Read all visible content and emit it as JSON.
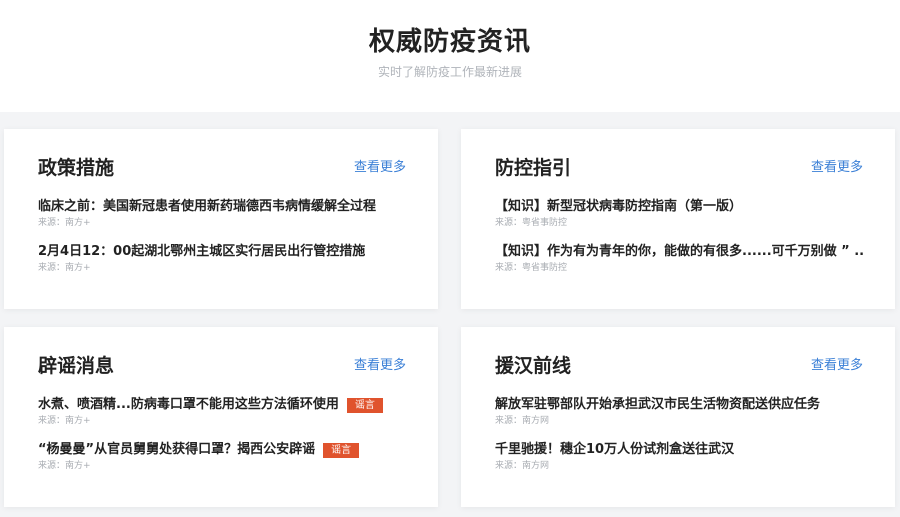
{
  "header": {
    "title": "权威防疫资讯",
    "subtitle": "实时了解防疫工作最新进展"
  },
  "cards": [
    {
      "title": "政策措施",
      "more": "查看更多",
      "items": [
        {
          "headline": "临床之前：美国新冠患者使用新药瑞德西韦病情缓解全过程",
          "source": "来源：南方+"
        },
        {
          "headline": "2月4日12：00起湖北鄂州主城区实行居民出行管控措施",
          "source": "来源：南方+"
        }
      ]
    },
    {
      "title": "防控指引",
      "more": "查看更多",
      "items": [
        {
          "headline": "【知识】新型冠状病毒防控指南（第一版）",
          "source": "来源：粤省事防控"
        },
        {
          "headline": "【知识】作为有为青年的你，能做的有很多......可千万别做 ” ...",
          "source": "来源：粤省事防控"
        }
      ]
    },
    {
      "title": "辟谣消息",
      "more": "查看更多",
      "items": [
        {
          "headline": "水煮、喷酒精...防病毒口罩不能用这些方法循环使用",
          "source": "来源：南方+",
          "tag": "谣言"
        },
        {
          "headline": "“杨曼曼”从官员舅舅处获得口罩？揭西公安辟谣",
          "source": "来源：南方+",
          "tag": "谣言"
        }
      ]
    },
    {
      "title": "援汉前线",
      "more": "查看更多",
      "items": [
        {
          "headline": "解放军驻鄂部队开始承担武汉市民生活物资配送供应任务",
          "source": "来源：南方网"
        },
        {
          "headline": "千里驰援！穗企10万人份试剂盒送往武汉",
          "source": "来源：南方网"
        }
      ]
    }
  ],
  "colors": {
    "accent": "#3a7fd6",
    "rumor_tag": "#e0532d",
    "background": "#f3f4f6",
    "card": "#ffffff"
  }
}
